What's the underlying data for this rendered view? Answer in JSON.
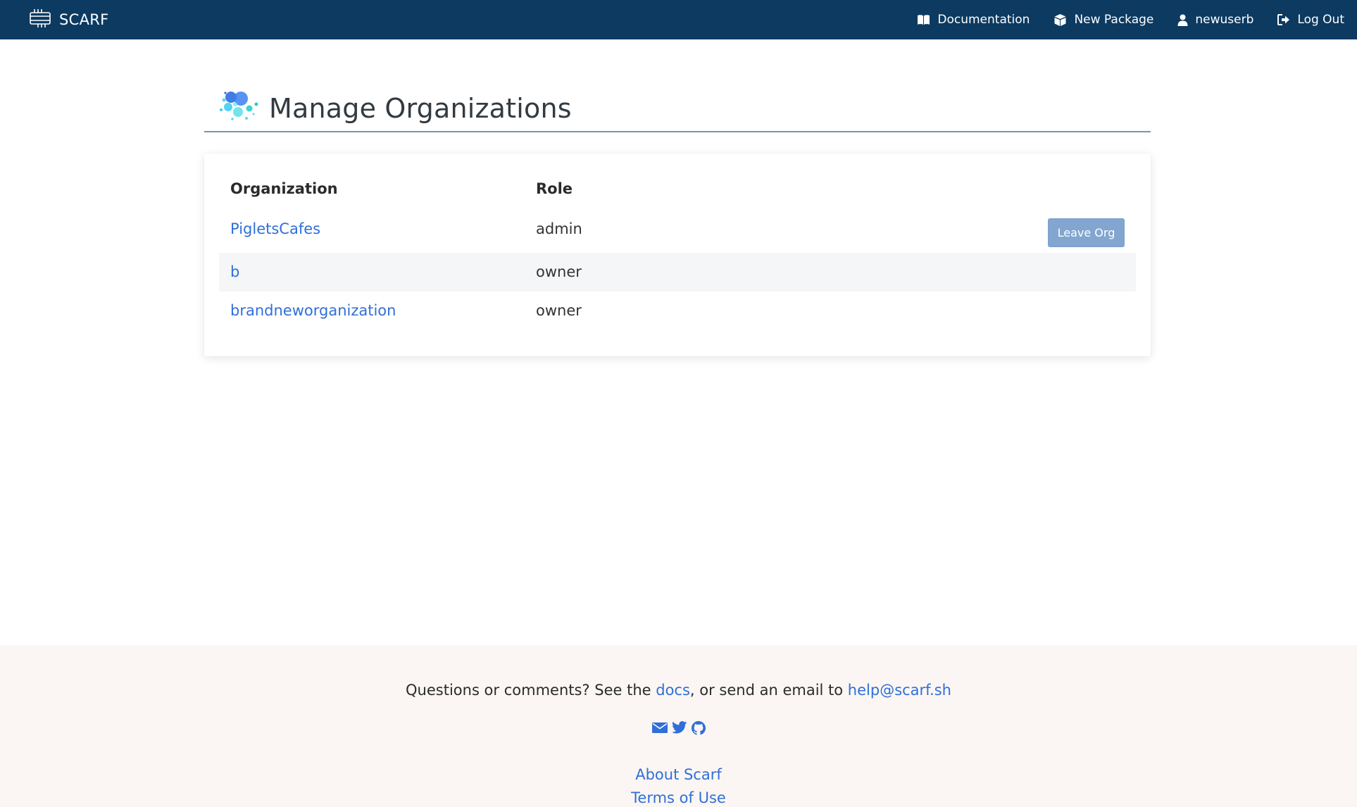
{
  "navbar": {
    "brand": "SCARF",
    "links": {
      "documentation": "Documentation",
      "new_package": "New Package",
      "user": "newuserb",
      "logout": "Log Out"
    }
  },
  "header": {
    "title": "Manage Organizations"
  },
  "table": {
    "columns": {
      "organization": "Organization",
      "role": "Role"
    },
    "rows": [
      {
        "organization": "PigletsCafes",
        "role": "admin",
        "action": "Leave Org"
      },
      {
        "organization": "b",
        "role": "owner"
      },
      {
        "organization": "brandneworganization",
        "role": "owner"
      }
    ]
  },
  "footer": {
    "text_before_docs": "Questions or comments? See the ",
    "docs_link": "docs",
    "text_middle": ", or send an email to ",
    "email_link": "help@scarf.sh",
    "social_icons": [
      "envelope-icon",
      "twitter-icon",
      "github-icon"
    ],
    "about": "About Scarf",
    "terms": "Terms of Use"
  },
  "colors": {
    "navbar_bg": "#0c3a61",
    "link": "#2f6fd8",
    "button_bg": "#82a6d0",
    "footer_bg": "#fbf6f3",
    "stripe": "#f4f6f8"
  }
}
